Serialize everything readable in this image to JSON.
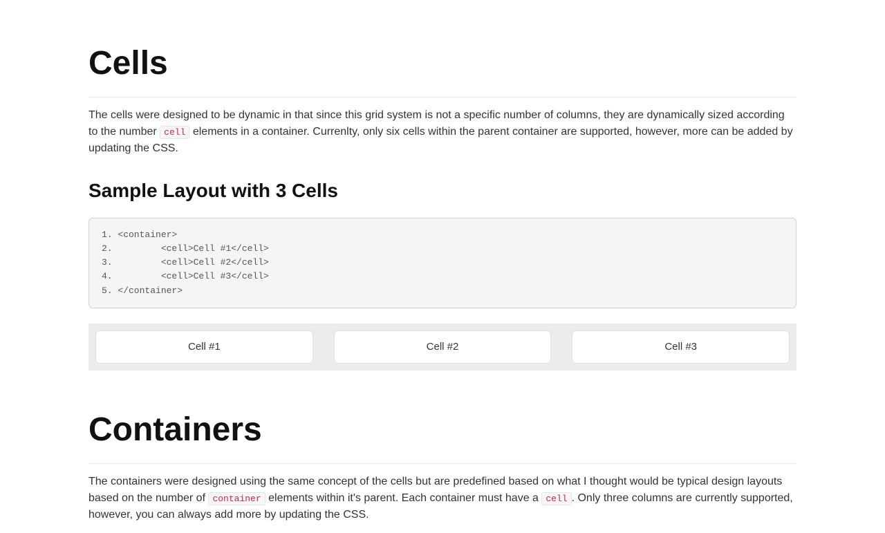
{
  "cells_section": {
    "heading": "Cells",
    "paragraph_before_code": "The cells were designed to be dynamic in that since this grid system is not a specific number of columns, they are dynamically sized according to the number ",
    "inline_code_cell": "cell",
    "paragraph_after_code": " elements in a container. Currenlty, only six cells within the parent container are supported, however, more can be added by updating the CSS.",
    "subheading": "Sample Layout with 3 Cells",
    "code_lines": [
      "1. <container>",
      "2.         <cell>Cell #1</cell>",
      "3.         <cell>Cell #2</cell>",
      "4.         <cell>Cell #3</cell>",
      "5. </container>"
    ],
    "demo_cells": [
      "Cell #1",
      "Cell #2",
      "Cell #3"
    ]
  },
  "containers_section": {
    "heading": "Containers",
    "p1_before_container": "The containers were designed using the same concept of the cells but are predefined based on what I thought would be typical design layouts based on the number of ",
    "inline_code_container": "container",
    "p1_between": " elements within it's parent. Each container must have a ",
    "inline_code_cell": "cell",
    "p1_after": ". Only three columns are currently supported, however, you can always add more by updating the CSS."
  }
}
